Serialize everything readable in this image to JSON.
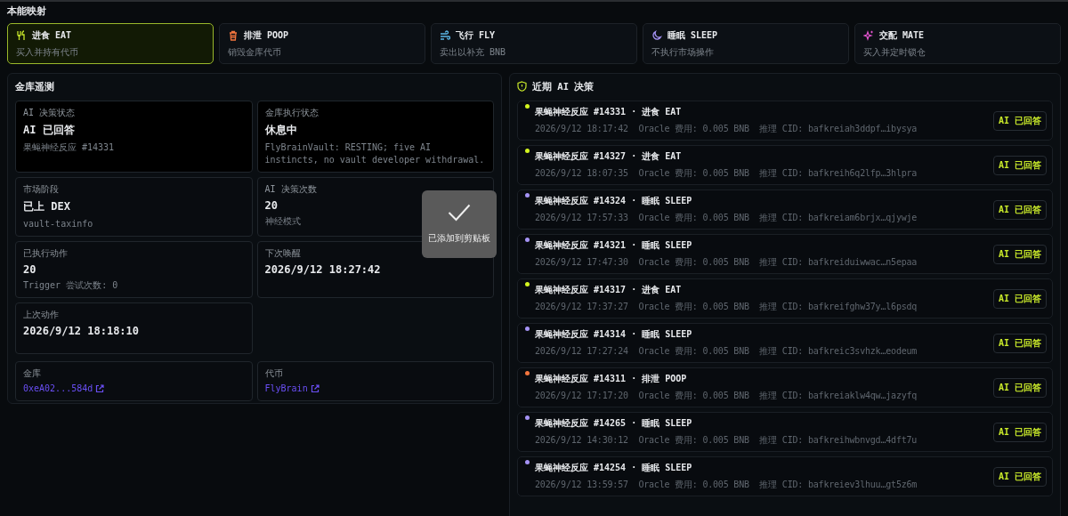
{
  "section_title": "本能映射",
  "instincts": [
    {
      "name": "进食 EAT",
      "desc": "买入并持有代币",
      "selected": true
    },
    {
      "name": "排泄 POOP",
      "desc": "销毁金库代币",
      "selected": false
    },
    {
      "name": "飞行 FLY",
      "desc": "卖出以补充 BNB",
      "selected": false
    },
    {
      "name": "睡眠 SLEEP",
      "desc": "不执行市场操作",
      "selected": false
    },
    {
      "name": "交配 MATE",
      "desc": "买入并定时锁仓",
      "selected": false
    }
  ],
  "telemetry": {
    "title": "金库遥测",
    "stats": [
      {
        "label": "AI 决策状态",
        "value": "AI 已回答",
        "sub": "果蝇神经反应 #14331",
        "highlight": true
      },
      {
        "label": "金库执行状态",
        "value": "休息中",
        "sub": "FlyBrainVault: RESTING; five AI instincts, no vault developer withdrawal.",
        "highlight": true
      },
      {
        "label": "市场阶段",
        "value": "已上 DEX",
        "sub": "vault-taxinfo",
        "highlight": false
      },
      {
        "label": "AI 决策次数",
        "value": "20",
        "sub": "神经模式",
        "highlight": false
      },
      {
        "label": "已执行动作",
        "value": "20",
        "sub": "Trigger 尝试次数: 0",
        "highlight": false
      },
      {
        "label": "下次唤醒",
        "value": "2026/9/12 18:27:42",
        "highlight": false
      },
      {
        "label": "上次动作",
        "value": "2026/9/12 18:18:10",
        "highlight": false
      }
    ],
    "links": [
      {
        "label": "金库",
        "link": "0xeA02...584d"
      },
      {
        "label": "代币",
        "link": "FlyBrain"
      }
    ]
  },
  "decisions": {
    "title": "近期 AI 决策",
    "items": [
      {
        "color": "#d4f520",
        "title": "果蝇神经反应 #14331 · 进食 EAT",
        "meta": "2026/9/12 18:17:42  Oracle 费用: 0.005 BNB  推理 CID: bafkreiah3ddpf…ibysya",
        "badge": "AI 已回答"
      },
      {
        "color": "#d4f520",
        "title": "果蝇神经反应 #14327 · 进食 EAT",
        "meta": "2026/9/12 18:07:35  Oracle 费用: 0.005 BNB  推理 CID: bafkreih6q2lfp…3hlpra",
        "badge": "AI 已回答"
      },
      {
        "color": "#a593f5",
        "title": "果蝇神经反应 #14324 · 睡眠 SLEEP",
        "meta": "2026/9/12 17:57:33  Oracle 费用: 0.005 BNB  推理 CID: bafkreiam6brjx…qjywje",
        "badge": "AI 已回答"
      },
      {
        "color": "#a593f5",
        "title": "果蝇神经反应 #14321 · 睡眠 SLEEP",
        "meta": "2026/9/12 17:47:30  Oracle 费用: 0.005 BNB  推理 CID: bafkreiduiwwac…n5epaa",
        "badge": "AI 已回答"
      },
      {
        "color": "#d4f520",
        "title": "果蝇神经反应 #14317 · 进食 EAT",
        "meta": "2026/9/12 17:37:27  Oracle 费用: 0.005 BNB  推理 CID: bafkreifghw37y…l6psdq",
        "badge": "AI 已回答"
      },
      {
        "color": "#a593f5",
        "title": "果蝇神经反应 #14314 · 睡眠 SLEEP",
        "meta": "2026/9/12 17:27:24  Oracle 费用: 0.005 BNB  推理 CID: bafkreic3svhzk…eodeum",
        "badge": "AI 已回答"
      },
      {
        "color": "#f4753e",
        "title": "果蝇神经反应 #14311 · 排泄 POOP",
        "meta": "2026/9/12 17:17:20  Oracle 费用: 0.005 BNB  推理 CID: bafkreiaklw4qw…jazyfq",
        "badge": "AI 已回答"
      },
      {
        "color": "#a593f5",
        "title": "果蝇神经反应 #14265 · 睡眠 SLEEP",
        "meta": "2026/9/12 14:30:12  Oracle 费用: 0.005 BNB  推理 CID: bafkreihwbnvgd…4dft7u",
        "badge": "AI 已回答"
      },
      {
        "color": "#a593f5",
        "title": "果蝇神经反应 #14254 · 睡眠 SLEEP",
        "meta": "2026/9/12 13:59:57  Oracle 费用: 0.005 BNB  推理 CID: bafkreiev3lhuu…gt5z6m",
        "badge": "AI 已回答"
      }
    ]
  },
  "toast": {
    "message": "已添加到剪贴板"
  }
}
